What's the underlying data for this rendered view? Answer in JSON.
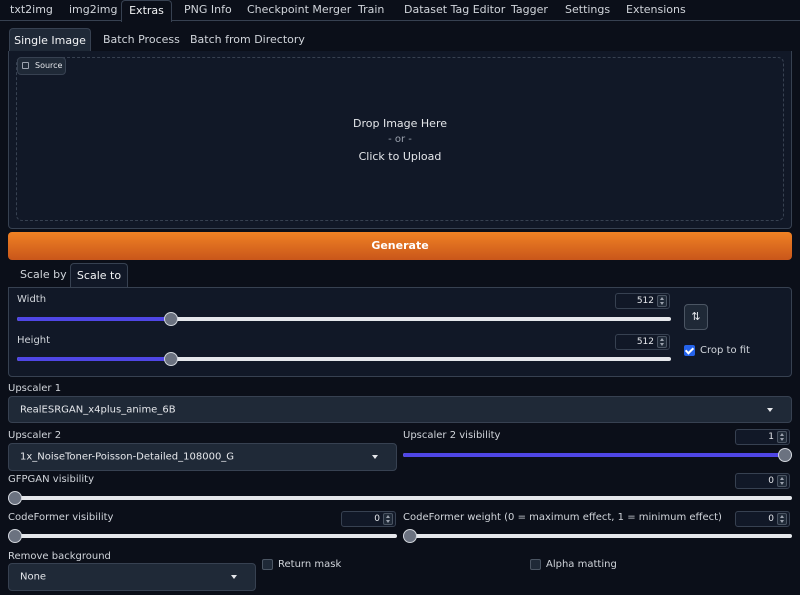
{
  "top_tabs": [
    "txt2img",
    "img2img",
    "Extras",
    "PNG Info",
    "Checkpoint Merger",
    "Train",
    "Dataset Tag Editor",
    "Tagger",
    "Settings",
    "Extensions"
  ],
  "sub_tabs": [
    "Single Image",
    "Batch Process",
    "Batch from Directory"
  ],
  "source": {
    "label": "Source",
    "drop_text": "Drop Image Here",
    "or_text": "- or -",
    "click_text": "Click to Upload"
  },
  "generate_label": "Generate",
  "scale_tabs": [
    "Scale by",
    "Scale to"
  ],
  "width": {
    "label": "Width",
    "value": "512",
    "fraction": 0.23
  },
  "height": {
    "label": "Height",
    "value": "512",
    "fraction": 0.23
  },
  "swap_icon": "swap-icon",
  "crop_to_fit": {
    "label": "Crop to fit",
    "checked": true
  },
  "upscaler1": {
    "label": "Upscaler 1",
    "value": "RealESRGAN_x4plus_anime_6B"
  },
  "upscaler2": {
    "label": "Upscaler 2",
    "value": "1x_NoiseToner-Poisson-Detailed_108000_G"
  },
  "upscaler2_visibility": {
    "label": "Upscaler 2 visibility",
    "value": "1",
    "fraction": 1.0
  },
  "gfpgan_visibility": {
    "label": "GFPGAN visibility",
    "value": "0",
    "fraction": 0.0
  },
  "codeformer_visibility": {
    "label": "CodeFormer visibility",
    "value": "0",
    "fraction": 0.0
  },
  "codeformer_weight": {
    "label": "CodeFormer weight (0 = maximum effect, 1 = minimum effect)",
    "value": "0",
    "fraction": 0.0
  },
  "remove_background": {
    "label": "Remove background",
    "value": "None"
  },
  "return_mask": {
    "label": "Return mask",
    "checked": false
  },
  "alpha_matting": {
    "label": "Alpha matting",
    "checked": false
  },
  "colors": {
    "accent": "#4f46e5",
    "generate": "#e5701f",
    "background": "#0b0f19"
  }
}
